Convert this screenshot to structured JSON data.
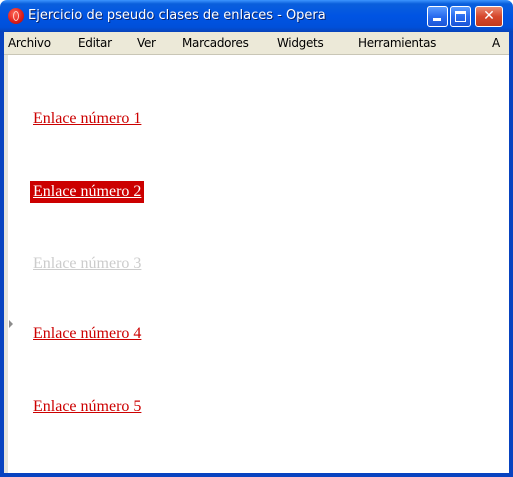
{
  "window": {
    "title": "Ejercicio de pseudo clases de enlaces - Opera",
    "close_glyph": "✕"
  },
  "menu": {
    "items": [
      "Archivo",
      "Editar",
      "Ver",
      "Marcadores",
      "Widgets",
      "Herramientas",
      "A"
    ]
  },
  "content": {
    "links": [
      {
        "label": "Enlace número 1",
        "state": "normal"
      },
      {
        "label": "Enlace número 2",
        "state": "hover"
      },
      {
        "label": "Enlace número 3",
        "state": "disabled"
      },
      {
        "label": "Enlace número 4",
        "state": "normal"
      },
      {
        "label": "Enlace número 5",
        "state": "normal"
      }
    ]
  },
  "colors": {
    "link": "#cc0000",
    "link_hover_bg": "#cc0000",
    "link_hover_text": "#ffffff",
    "link_disabled": "#cccccc",
    "titlebar": "#0054e3",
    "menubar": "#ece9d8"
  },
  "icons": {
    "app": "opera-icon",
    "minimize": "minimize-icon",
    "maximize": "maximize-icon",
    "close": "close-icon"
  }
}
